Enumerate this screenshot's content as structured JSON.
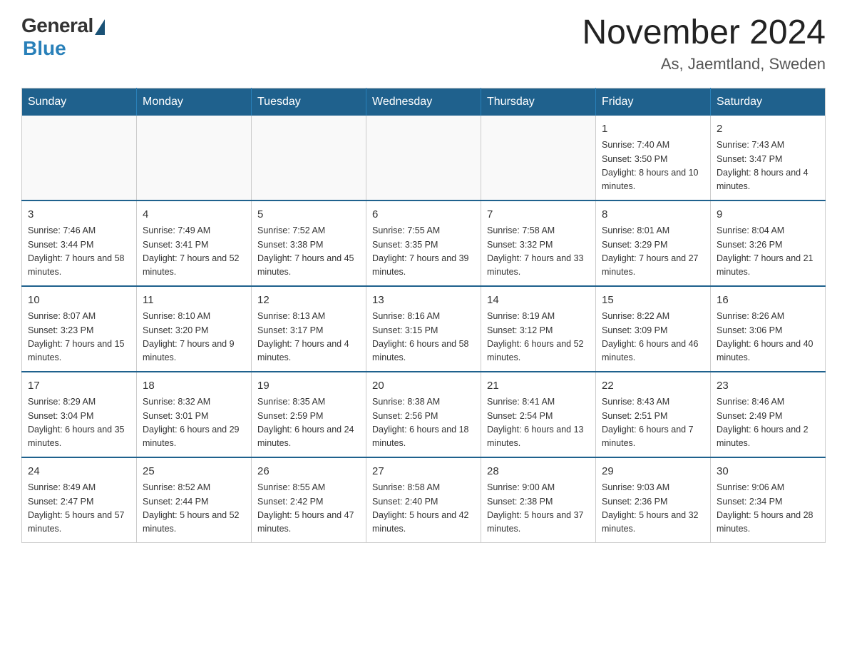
{
  "header": {
    "logo_general": "General",
    "logo_blue": "Blue",
    "month_title": "November 2024",
    "location": "As, Jaemtland, Sweden"
  },
  "days_of_week": [
    "Sunday",
    "Monday",
    "Tuesday",
    "Wednesday",
    "Thursday",
    "Friday",
    "Saturday"
  ],
  "weeks": [
    [
      {
        "day": "",
        "sunrise": "",
        "sunset": "",
        "daylight": "",
        "empty": true
      },
      {
        "day": "",
        "sunrise": "",
        "sunset": "",
        "daylight": "",
        "empty": true
      },
      {
        "day": "",
        "sunrise": "",
        "sunset": "",
        "daylight": "",
        "empty": true
      },
      {
        "day": "",
        "sunrise": "",
        "sunset": "",
        "daylight": "",
        "empty": true
      },
      {
        "day": "",
        "sunrise": "",
        "sunset": "",
        "daylight": "",
        "empty": true
      },
      {
        "day": "1",
        "sunrise": "Sunrise: 7:40 AM",
        "sunset": "Sunset: 3:50 PM",
        "daylight": "Daylight: 8 hours and 10 minutes.",
        "empty": false
      },
      {
        "day": "2",
        "sunrise": "Sunrise: 7:43 AM",
        "sunset": "Sunset: 3:47 PM",
        "daylight": "Daylight: 8 hours and 4 minutes.",
        "empty": false
      }
    ],
    [
      {
        "day": "3",
        "sunrise": "Sunrise: 7:46 AM",
        "sunset": "Sunset: 3:44 PM",
        "daylight": "Daylight: 7 hours and 58 minutes.",
        "empty": false
      },
      {
        "day": "4",
        "sunrise": "Sunrise: 7:49 AM",
        "sunset": "Sunset: 3:41 PM",
        "daylight": "Daylight: 7 hours and 52 minutes.",
        "empty": false
      },
      {
        "day": "5",
        "sunrise": "Sunrise: 7:52 AM",
        "sunset": "Sunset: 3:38 PM",
        "daylight": "Daylight: 7 hours and 45 minutes.",
        "empty": false
      },
      {
        "day": "6",
        "sunrise": "Sunrise: 7:55 AM",
        "sunset": "Sunset: 3:35 PM",
        "daylight": "Daylight: 7 hours and 39 minutes.",
        "empty": false
      },
      {
        "day": "7",
        "sunrise": "Sunrise: 7:58 AM",
        "sunset": "Sunset: 3:32 PM",
        "daylight": "Daylight: 7 hours and 33 minutes.",
        "empty": false
      },
      {
        "day": "8",
        "sunrise": "Sunrise: 8:01 AM",
        "sunset": "Sunset: 3:29 PM",
        "daylight": "Daylight: 7 hours and 27 minutes.",
        "empty": false
      },
      {
        "day": "9",
        "sunrise": "Sunrise: 8:04 AM",
        "sunset": "Sunset: 3:26 PM",
        "daylight": "Daylight: 7 hours and 21 minutes.",
        "empty": false
      }
    ],
    [
      {
        "day": "10",
        "sunrise": "Sunrise: 8:07 AM",
        "sunset": "Sunset: 3:23 PM",
        "daylight": "Daylight: 7 hours and 15 minutes.",
        "empty": false
      },
      {
        "day": "11",
        "sunrise": "Sunrise: 8:10 AM",
        "sunset": "Sunset: 3:20 PM",
        "daylight": "Daylight: 7 hours and 9 minutes.",
        "empty": false
      },
      {
        "day": "12",
        "sunrise": "Sunrise: 8:13 AM",
        "sunset": "Sunset: 3:17 PM",
        "daylight": "Daylight: 7 hours and 4 minutes.",
        "empty": false
      },
      {
        "day": "13",
        "sunrise": "Sunrise: 8:16 AM",
        "sunset": "Sunset: 3:15 PM",
        "daylight": "Daylight: 6 hours and 58 minutes.",
        "empty": false
      },
      {
        "day": "14",
        "sunrise": "Sunrise: 8:19 AM",
        "sunset": "Sunset: 3:12 PM",
        "daylight": "Daylight: 6 hours and 52 minutes.",
        "empty": false
      },
      {
        "day": "15",
        "sunrise": "Sunrise: 8:22 AM",
        "sunset": "Sunset: 3:09 PM",
        "daylight": "Daylight: 6 hours and 46 minutes.",
        "empty": false
      },
      {
        "day": "16",
        "sunrise": "Sunrise: 8:26 AM",
        "sunset": "Sunset: 3:06 PM",
        "daylight": "Daylight: 6 hours and 40 minutes.",
        "empty": false
      }
    ],
    [
      {
        "day": "17",
        "sunrise": "Sunrise: 8:29 AM",
        "sunset": "Sunset: 3:04 PM",
        "daylight": "Daylight: 6 hours and 35 minutes.",
        "empty": false
      },
      {
        "day": "18",
        "sunrise": "Sunrise: 8:32 AM",
        "sunset": "Sunset: 3:01 PM",
        "daylight": "Daylight: 6 hours and 29 minutes.",
        "empty": false
      },
      {
        "day": "19",
        "sunrise": "Sunrise: 8:35 AM",
        "sunset": "Sunset: 2:59 PM",
        "daylight": "Daylight: 6 hours and 24 minutes.",
        "empty": false
      },
      {
        "day": "20",
        "sunrise": "Sunrise: 8:38 AM",
        "sunset": "Sunset: 2:56 PM",
        "daylight": "Daylight: 6 hours and 18 minutes.",
        "empty": false
      },
      {
        "day": "21",
        "sunrise": "Sunrise: 8:41 AM",
        "sunset": "Sunset: 2:54 PM",
        "daylight": "Daylight: 6 hours and 13 minutes.",
        "empty": false
      },
      {
        "day": "22",
        "sunrise": "Sunrise: 8:43 AM",
        "sunset": "Sunset: 2:51 PM",
        "daylight": "Daylight: 6 hours and 7 minutes.",
        "empty": false
      },
      {
        "day": "23",
        "sunrise": "Sunrise: 8:46 AM",
        "sunset": "Sunset: 2:49 PM",
        "daylight": "Daylight: 6 hours and 2 minutes.",
        "empty": false
      }
    ],
    [
      {
        "day": "24",
        "sunrise": "Sunrise: 8:49 AM",
        "sunset": "Sunset: 2:47 PM",
        "daylight": "Daylight: 5 hours and 57 minutes.",
        "empty": false
      },
      {
        "day": "25",
        "sunrise": "Sunrise: 8:52 AM",
        "sunset": "Sunset: 2:44 PM",
        "daylight": "Daylight: 5 hours and 52 minutes.",
        "empty": false
      },
      {
        "day": "26",
        "sunrise": "Sunrise: 8:55 AM",
        "sunset": "Sunset: 2:42 PM",
        "daylight": "Daylight: 5 hours and 47 minutes.",
        "empty": false
      },
      {
        "day": "27",
        "sunrise": "Sunrise: 8:58 AM",
        "sunset": "Sunset: 2:40 PM",
        "daylight": "Daylight: 5 hours and 42 minutes.",
        "empty": false
      },
      {
        "day": "28",
        "sunrise": "Sunrise: 9:00 AM",
        "sunset": "Sunset: 2:38 PM",
        "daylight": "Daylight: 5 hours and 37 minutes.",
        "empty": false
      },
      {
        "day": "29",
        "sunrise": "Sunrise: 9:03 AM",
        "sunset": "Sunset: 2:36 PM",
        "daylight": "Daylight: 5 hours and 32 minutes.",
        "empty": false
      },
      {
        "day": "30",
        "sunrise": "Sunrise: 9:06 AM",
        "sunset": "Sunset: 2:34 PM",
        "daylight": "Daylight: 5 hours and 28 minutes.",
        "empty": false
      }
    ]
  ]
}
